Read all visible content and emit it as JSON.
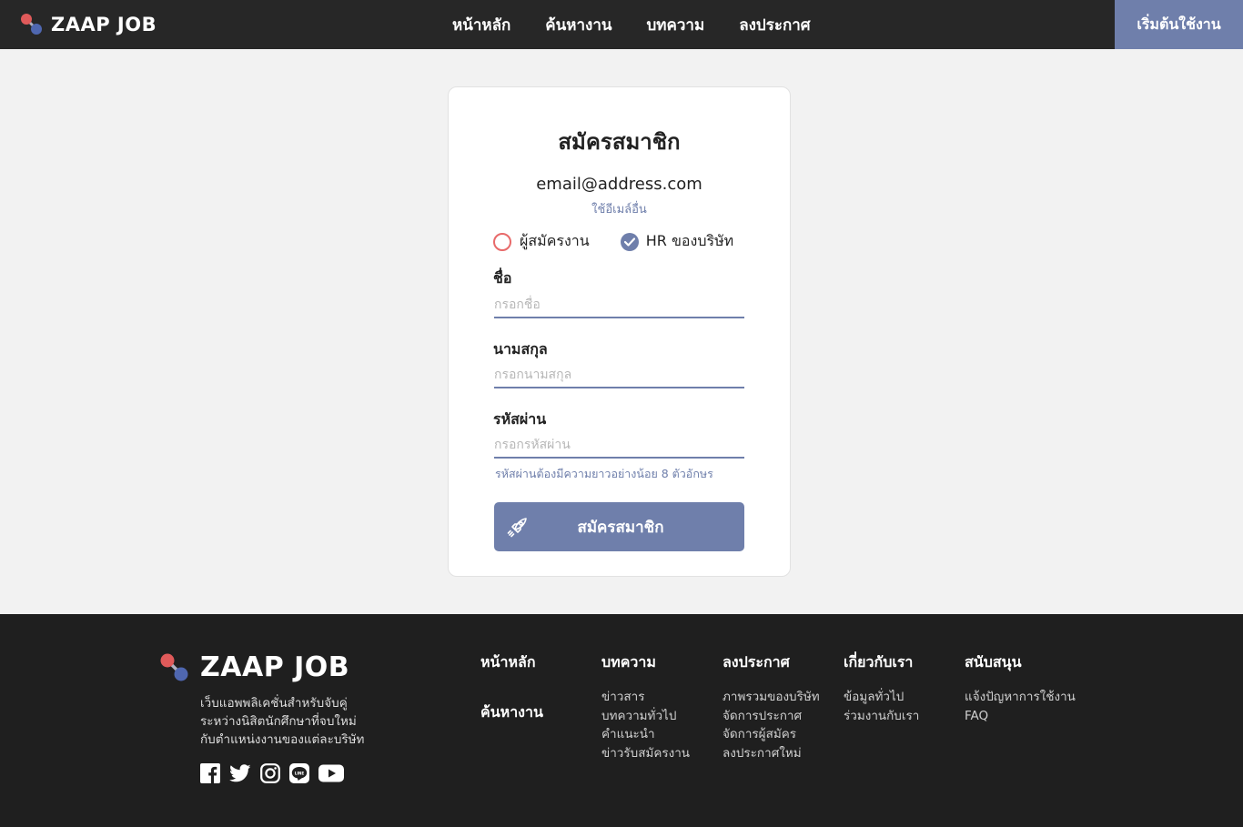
{
  "colors": {
    "accent": "#6f7fab",
    "header_bg": "#272727",
    "footer_bg": "#1f1f1f",
    "logo_red": "#e05a5a",
    "logo_blue": "#4f67b0"
  },
  "header": {
    "brand": "ZAAP JOB",
    "nav": [
      "หน้าหลัก",
      "ค้นหางาน",
      "บทความ",
      "ลงประกาศ"
    ],
    "start_button": "เริ่มต้นใช้งาน"
  },
  "form": {
    "title": "สมัครสมาชิก",
    "email": "email@address.com",
    "change_email": "ใช้อีเมล์อื่น",
    "roles": [
      {
        "label": "ผู้สมัครงาน",
        "checked": false
      },
      {
        "label": "HR ของบริษัท",
        "checked": true
      }
    ],
    "first_name": {
      "label": "ชื่อ",
      "placeholder": "กรอกชื่อ",
      "value": ""
    },
    "last_name": {
      "label": "นามสกุล",
      "placeholder": "กรอกนามสกุล",
      "value": ""
    },
    "password": {
      "label": "รหัสผ่าน",
      "placeholder": "กรอกรหัสผ่าน",
      "value": ""
    },
    "password_hint": "รหัสผ่านต้องมีความยาวอย่างน้อย 8 ตัวอักษร",
    "submit_label": "สมัครสมาชิก",
    "submit_icon": "rocket-icon"
  },
  "footer": {
    "brand": "ZAAP JOB",
    "description": [
      "เว็บแอพพลิเคชั่นสำหรับจับคู่",
      "ระหว่างนิสิตนักศึกษาที่จบใหม่",
      "กับตำแหน่งงานของแต่ละบริษัท"
    ],
    "socials": [
      "facebook-icon",
      "twitter-icon",
      "instagram-icon",
      "line-icon",
      "youtube-icon"
    ],
    "main_links": [
      "หน้าหลัก",
      "ค้นหางาน"
    ],
    "columns": [
      {
        "title": "บทความ",
        "links": [
          "ข่าวสาร",
          "บทความทั่วไป",
          "คำแนะนำ",
          "ข่าวรับสมัครงาน"
        ]
      },
      {
        "title": "ลงประกาศ",
        "links": [
          "ภาพรวมของบริษัท",
          "จัดการประกาศ",
          "จัดการผู้สมัคร",
          "ลงประกาศใหม่"
        ]
      },
      {
        "title": "เกี่ยวกับเรา",
        "links": [
          "ข้อมูลทั่วไป",
          "ร่วมงานกับเรา"
        ]
      },
      {
        "title": "สนับสนุน",
        "links": [
          "แจ้งปัญหาการใช้งาน",
          "FAQ"
        ]
      }
    ]
  }
}
